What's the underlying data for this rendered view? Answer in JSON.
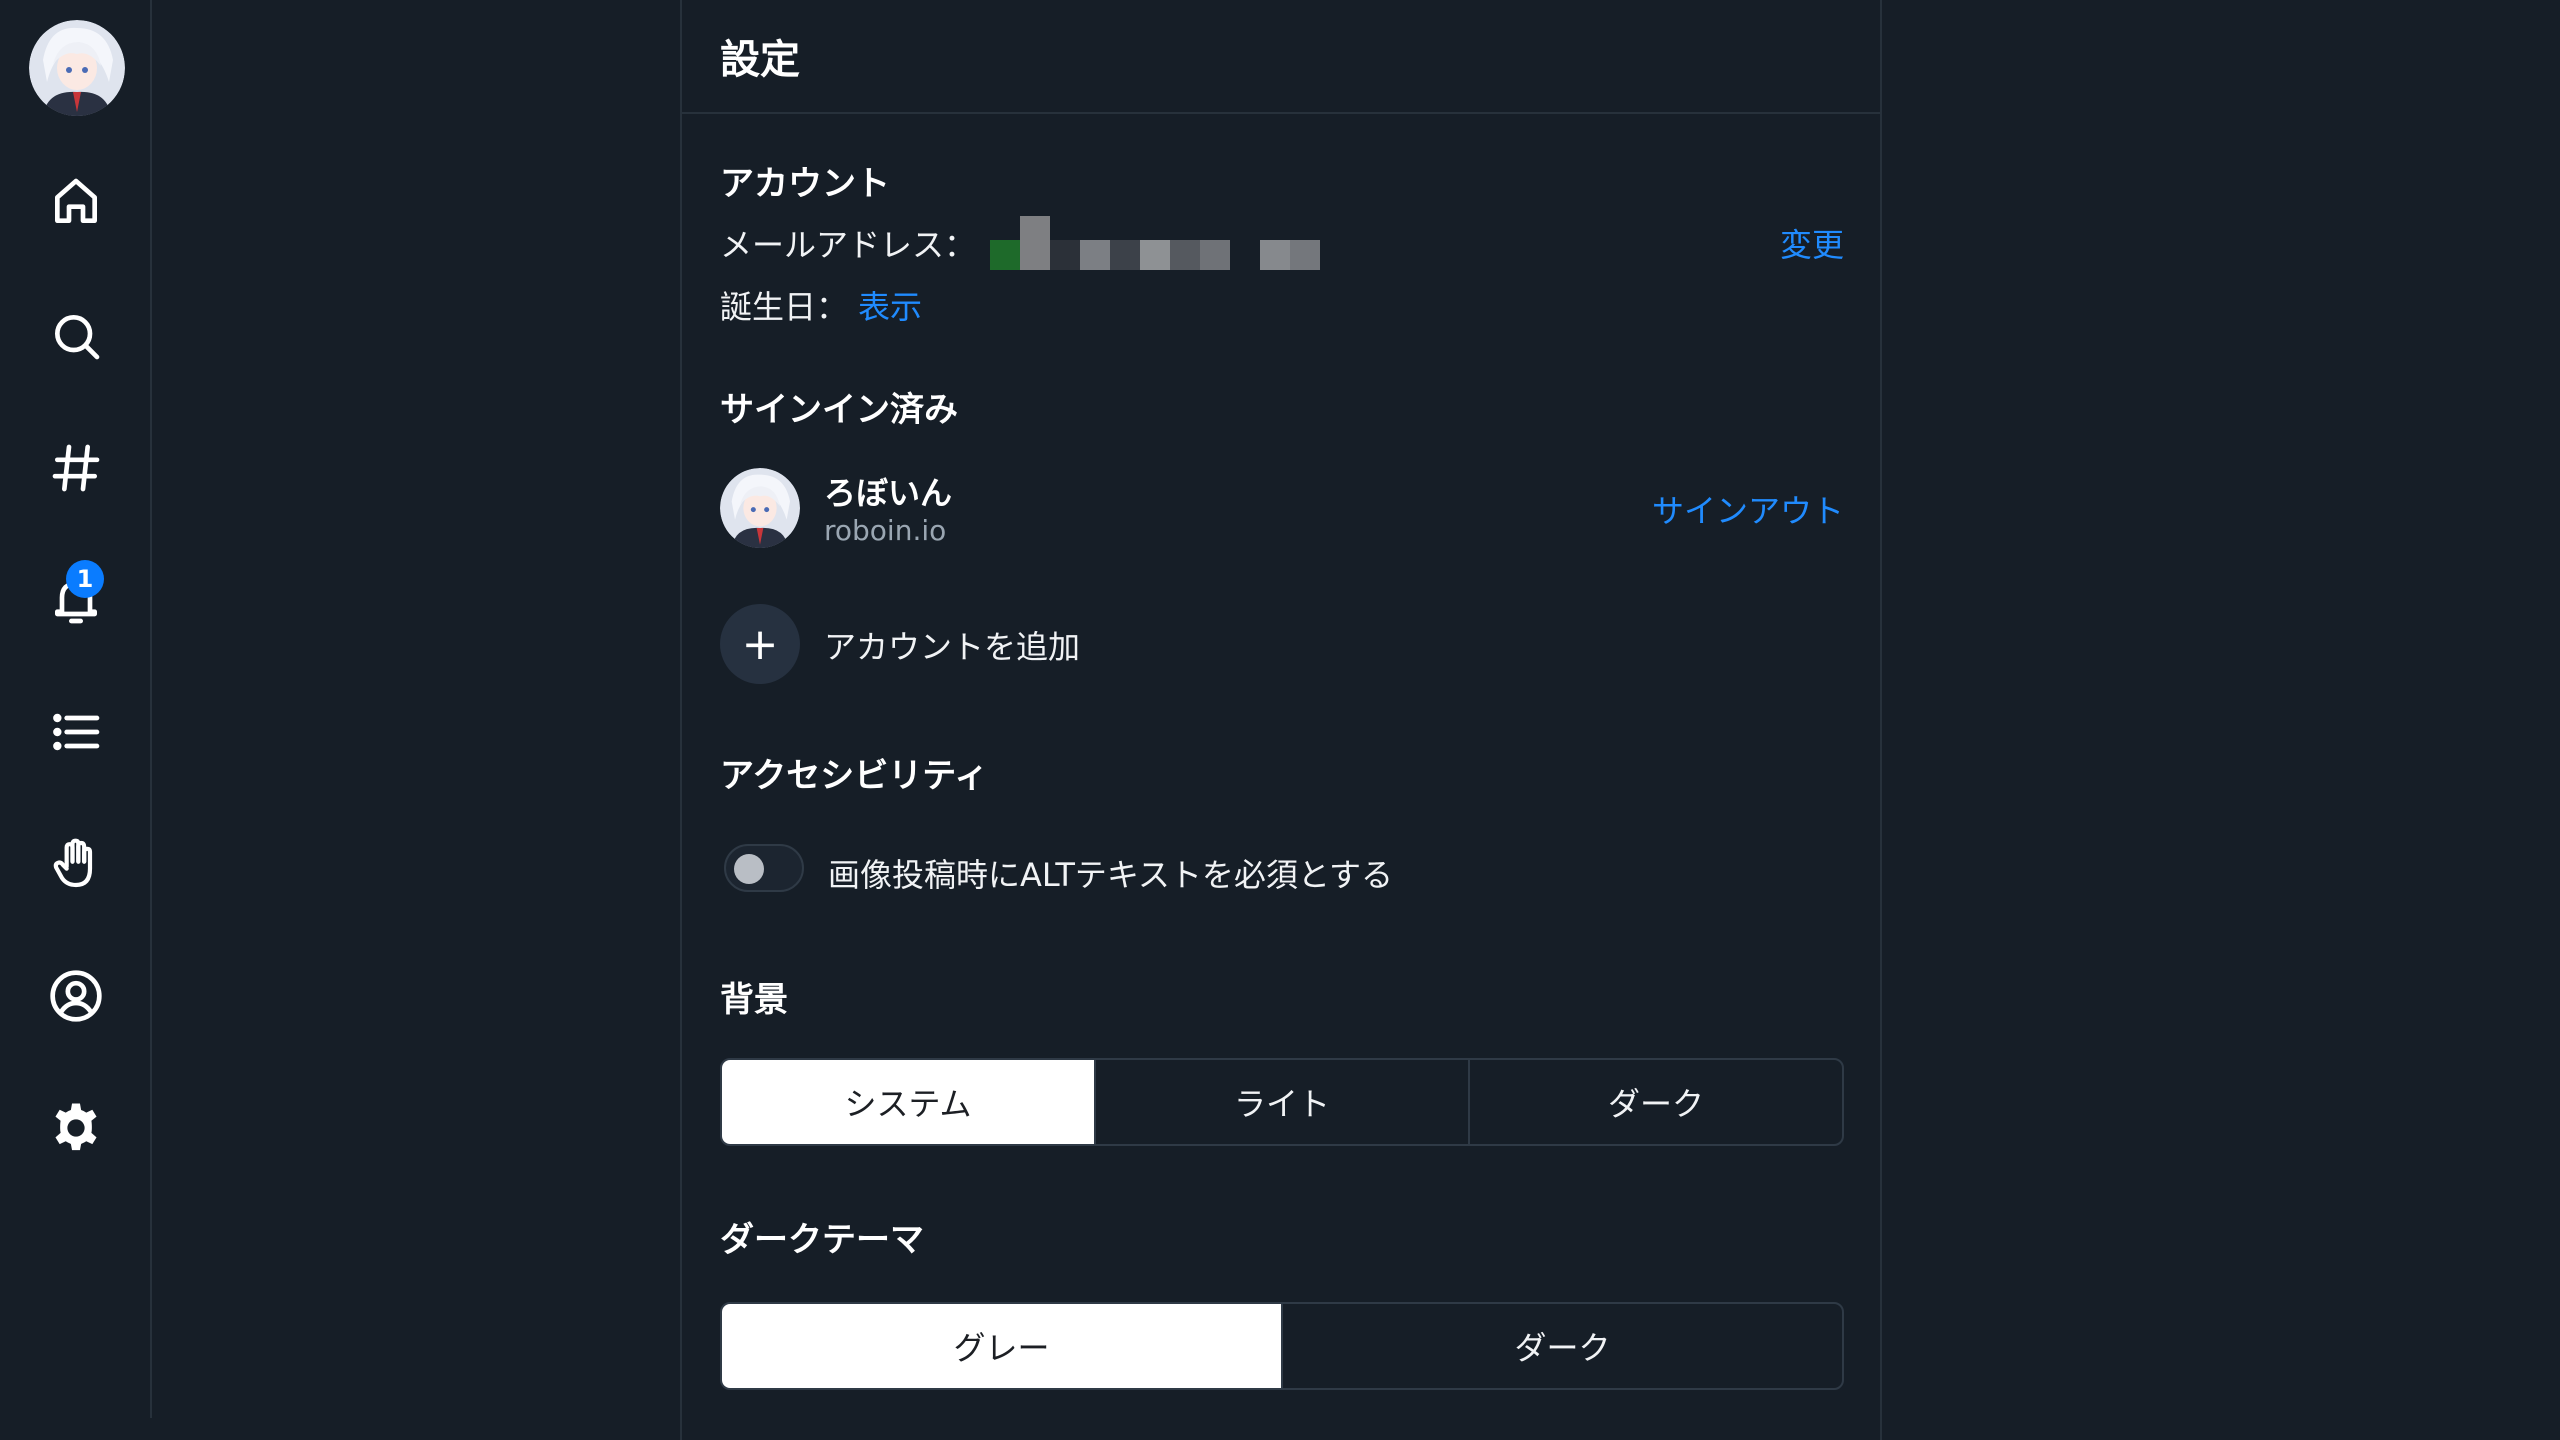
{
  "nav": {
    "items": [
      {
        "name": "home-icon"
      },
      {
        "name": "search-icon"
      },
      {
        "name": "hashtag-icon"
      },
      {
        "name": "bell-icon"
      },
      {
        "name": "list-icon"
      },
      {
        "name": "hand-icon"
      },
      {
        "name": "profile-icon"
      },
      {
        "name": "gear-icon"
      }
    ],
    "notification_badge": "1"
  },
  "header": {
    "title": "設定"
  },
  "account": {
    "title": "アカウント",
    "email_label": "メールアドレス：",
    "change_link": "変更",
    "birthday_label": "誕生日：",
    "birthday_link": "表示"
  },
  "signed_in": {
    "title": "サインイン済み",
    "name": "ろぼいん",
    "handle": "roboin.io",
    "signout_link": "サインアウト",
    "add_account": "アカウントを追加",
    "add_icon": "+"
  },
  "accessibility": {
    "title": "アクセシビリティ",
    "alt_required_label": "画像投稿時にALTテキストを必須とする",
    "alt_required_on": false
  },
  "background": {
    "title": "背景",
    "options": [
      "システム",
      "ライト",
      "ダーク"
    ],
    "selected": "システム"
  },
  "dark_theme": {
    "title": "ダークテーマ",
    "options": [
      "グレー",
      "ダーク"
    ],
    "selected": "グレー"
  },
  "colors": {
    "background": "#161e27",
    "border": "#27313b",
    "link": "#208bfe",
    "badge": "#0a7cff"
  }
}
